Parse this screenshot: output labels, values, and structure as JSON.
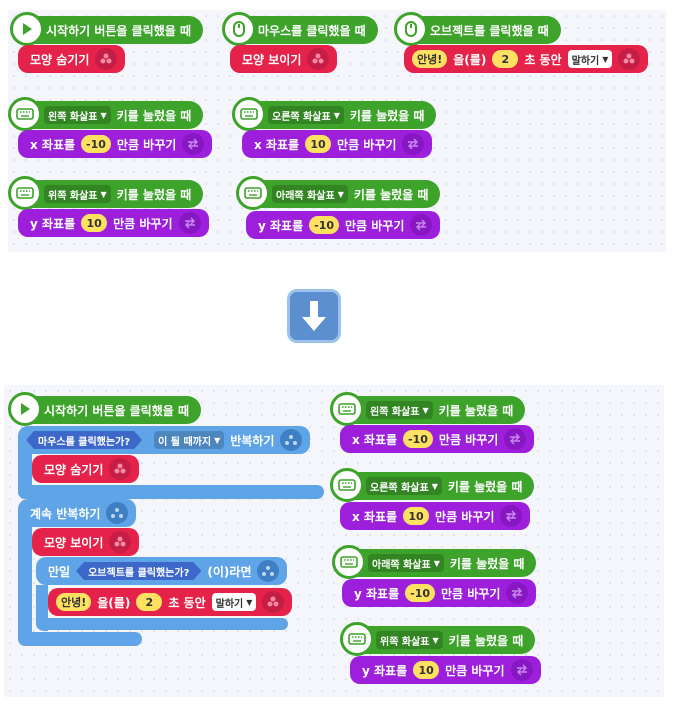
{
  "top": {
    "start_event": "시작하기 버튼을 클릭했을 때",
    "hide_shape": "모양 숨기기",
    "mouse_click_event": "마우스를 클릭했을 때",
    "show_shape": "모양 보이기",
    "object_click_event": "오브젝트를 클릭했을 때",
    "say_text": "안녕!",
    "say_particle": "을(를)",
    "say_seconds": "2",
    "say_seconds_suffix": "초 동안",
    "say_mode": "말하기",
    "key_left": "왼쪽 화살표",
    "key_right": "오른쪽 화살표",
    "key_up": "위쪽 화살표",
    "key_down": "아래쪽 화살표",
    "key_pressed": "키를 눌렀을 때",
    "x_label": "x 좌표를",
    "y_label": "y 좌표를",
    "change_suffix": "만큼 바꾸기",
    "val_neg10": "-10",
    "val_10": "10"
  },
  "bottom": {
    "start_event": "시작하기 버튼을 클릭했을 때",
    "mouse_clicked_q": "마우스를 클릭했는가?",
    "until_true": "이 될 때까지",
    "repeat": "반복하기",
    "hide_shape": "모양 숨기기",
    "forever": "계속 반복하기",
    "show_shape": "모양 보이기",
    "if_label": "만일",
    "object_clicked_q": "오브젝트를 클릭했는가?",
    "if_suffix": "(이)라면",
    "say_text": "안녕!",
    "say_particle": "을(를)",
    "say_seconds": "2",
    "say_seconds_suffix": "초 동안",
    "say_mode": "말하기"
  },
  "icons": {
    "play": "play-icon",
    "mouse": "mouse-icon",
    "keyboard": "keyboard-icon",
    "looks": "looks-icon",
    "move": "move-icon",
    "flow": "flow-icon",
    "down_arrow": "down-arrow-icon"
  },
  "colors": {
    "event": "#3da32a",
    "looks": "#e5224a",
    "move": "#9d1fdc",
    "flow": "#5fa4e7",
    "number_pill": "#ffe161",
    "condition": "#3d67c9"
  }
}
